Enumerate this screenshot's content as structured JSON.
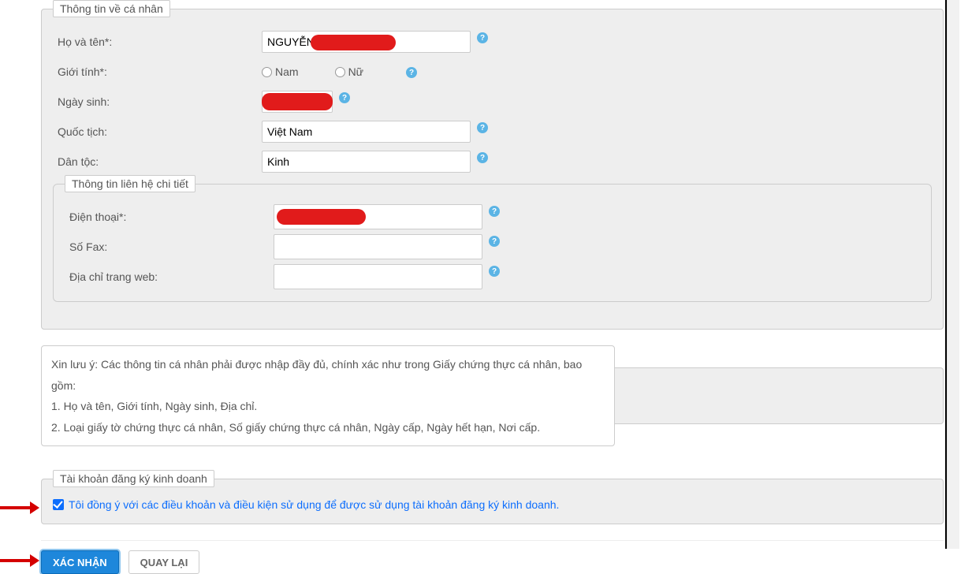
{
  "personal": {
    "legend": "Thông tin về cá nhân",
    "fullname_label": "Họ và tên*:",
    "fullname_value": "NGUYỄN",
    "gender_label": "Giới tính*:",
    "gender_male": "Nam",
    "gender_female": "Nữ",
    "dob_label": "Ngày sinh:",
    "dob_value": "",
    "nationality_label": "Quốc tịch:",
    "nationality_value": "Việt Nam",
    "ethnicity_label": "Dân tộc:",
    "ethnicity_value": "Kinh"
  },
  "contact": {
    "legend": "Thông tin liên hệ chi tiết",
    "phone_label": "Điện thoại*:",
    "phone_value": "",
    "fax_label": "Số Fax:",
    "fax_value": "",
    "web_label": "Địa chỉ trang web:",
    "web_value": ""
  },
  "notice": {
    "line1": "Xin lưu ý: Các thông tin cá nhân phải được nhập đầy đủ, chính xác như trong Giấy chứng thực cá nhân, bao gồm:",
    "line2": "1. Họ và tên, Giới tính, Ngày sinh, Địa chỉ.",
    "line3": "2. Loại giấy tờ chứng thực cá nhân, Số giấy chứng thực cá nhân, Ngày cấp, Ngày hết hạn, Nơi cấp."
  },
  "account": {
    "legend": "Tài khoản đăng ký kinh doanh",
    "terms_text": "Tôi đồng ý với các điều khoản và điều kiện sử dụng để được sử dụng tài khoản đăng ký kinh doanh."
  },
  "buttons": {
    "confirm": "XÁC NHẬN",
    "back": "QUAY LẠI"
  }
}
